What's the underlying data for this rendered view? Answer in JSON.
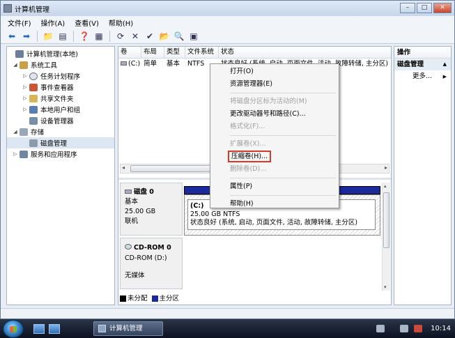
{
  "window": {
    "title": "计算机管理"
  },
  "menu": [
    "文件(F)",
    "操作(A)",
    "查看(V)",
    "帮助(H)"
  ],
  "toolbar_icons": [
    "back-arrow-icon",
    "forward-arrow-icon",
    "up-folder-icon",
    "show-hide-tree-icon",
    "help-icon",
    "properties-icon",
    "refresh-icon",
    "delete-icon",
    "check-icon",
    "open-folder-icon",
    "search-icon",
    "export-icon"
  ],
  "tree": {
    "items": [
      {
        "label": "计算机管理(本地)",
        "level": 0,
        "expander": "",
        "icon": "computer-management-icon"
      },
      {
        "label": "系统工具",
        "level": 1,
        "expander": "◢",
        "icon": "tools-icon"
      },
      {
        "label": "任务计划程序",
        "level": 2,
        "expander": "▷",
        "icon": "clock-icon"
      },
      {
        "label": "事件查看器",
        "level": 2,
        "expander": "▷",
        "icon": "event-viewer-icon"
      },
      {
        "label": "共享文件夹",
        "level": 2,
        "expander": "▷",
        "icon": "shared-folder-icon"
      },
      {
        "label": "本地用户和组",
        "level": 2,
        "expander": "▷",
        "icon": "users-icon"
      },
      {
        "label": "设备管理器",
        "level": 2,
        "expander": "",
        "icon": "device-manager-icon"
      },
      {
        "label": "存储",
        "level": 1,
        "expander": "◢",
        "icon": "storage-icon"
      },
      {
        "label": "磁盘管理",
        "level": 2,
        "expander": "",
        "icon": "disk-management-icon"
      },
      {
        "label": "服务和应用程序",
        "level": 1,
        "expander": "▷",
        "icon": "services-icon"
      }
    ]
  },
  "volume_table": {
    "headers": [
      "卷",
      "布局",
      "类型",
      "文件系统",
      "状态"
    ],
    "row": {
      "volume": "(C:)",
      "layout": "简单",
      "type": "基本",
      "fs": "NTFS",
      "status": "状态良好 (系统, 启动, 页面文件, 活动, 故障转储, 主分区)"
    }
  },
  "disks": {
    "disk0": {
      "name": "磁盘 0",
      "type": "基本",
      "size": "25.00 GB",
      "state": "联机"
    },
    "partition": {
      "name": "(C:)",
      "size": "25.00 GB NTFS",
      "status": "状态良好 (系统, 启动, 页面文件, 活动, 故障转储, 主分区)"
    },
    "cdrom": {
      "name": "CD-ROM 0",
      "drive": "CD-ROM (D:)",
      "media": "无媒体"
    }
  },
  "legend": [
    {
      "label": "未分配",
      "color": "#000000"
    },
    {
      "label": "主分区",
      "color": "#1a2a9a"
    }
  ],
  "actions": {
    "header": "操作",
    "section": "磁盘管理",
    "more": "更多..."
  },
  "context_menu": {
    "items": [
      {
        "label": "打开(O)",
        "disabled": false
      },
      {
        "label": "资源管理器(E)",
        "disabled": false
      },
      {
        "sep": true
      },
      {
        "label": "将磁盘分区标为活动的(M)",
        "disabled": true
      },
      {
        "label": "更改驱动器号和路径(C)...",
        "disabled": false
      },
      {
        "label": "格式化(F)...",
        "disabled": true
      },
      {
        "sep": true
      },
      {
        "label": "扩展卷(X)...",
        "disabled": true
      },
      {
        "label": "压缩卷(H)...",
        "disabled": false,
        "highlight": true
      },
      {
        "label": "删除卷(D)...",
        "disabled": true
      },
      {
        "sep": true
      },
      {
        "label": "属性(P)",
        "disabled": false
      },
      {
        "sep": true
      },
      {
        "label": "帮助(H)",
        "disabled": false
      }
    ]
  },
  "taskbar": {
    "task_label": "计算机管理",
    "clock": "10:14"
  }
}
